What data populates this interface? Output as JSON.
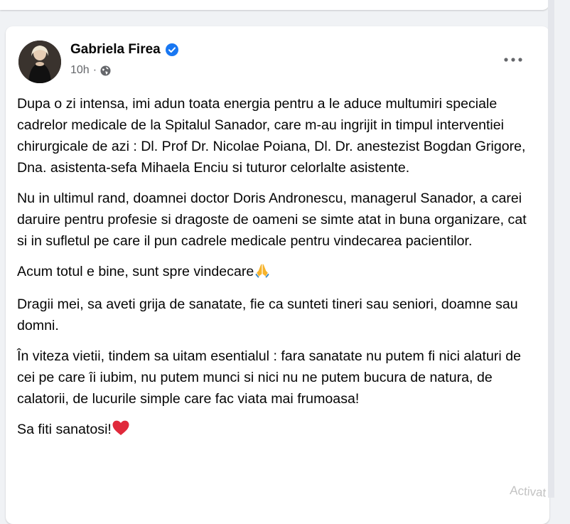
{
  "post": {
    "author": "Gabriela Firea",
    "verified": true,
    "time": "10h",
    "separator": "·",
    "audience_icon": "globe-icon",
    "more_icon": "more-options-icon",
    "paragraphs": [
      "Dupa o zi intensa, imi adun toata energia pentru a le aduce multumiri speciale cadrelor medicale de la Spitalul Sanador, care m-au ingrijit in timpul interventiei chirurgicale de azi : Dl. Prof Dr. Nicolae Poiana, Dl. Dr. anestezist Bogdan Grigore, Dna. asistenta-sefa Mihaela Enciu si tuturor celorlalte asistente.",
      "Nu in ultimul rand, doamnei doctor Doris Andronescu, managerul Sanador, a carei daruire pentru profesie si dragoste de oameni se simte atat in buna organizare, cat si in sufletul pe care il pun cadrele medicale pentru vindecarea pacientilor.",
      "Acum totul e bine, sunt spre vindecare",
      "Dragii mei, sa aveti grija de sanatate, fie ca sunteti tineri sau seniori, doamne sau domni.",
      "În viteza vietii, tindem sa uitam esentialul : fara sanatate nu putem fi nici alaturi de cei pe care îi iubim, nu putem munci si nici nu ne putem bucura de natura, de calatorii, de lucurile simple care fac viata mai frumoasa!",
      "Sa fiti sanatosi!"
    ]
  },
  "colors": {
    "verified_blue": "#1877f2",
    "heart_red": "#e0293b",
    "text": "#050505",
    "secondary": "#65676b"
  },
  "watermark": "Activat"
}
